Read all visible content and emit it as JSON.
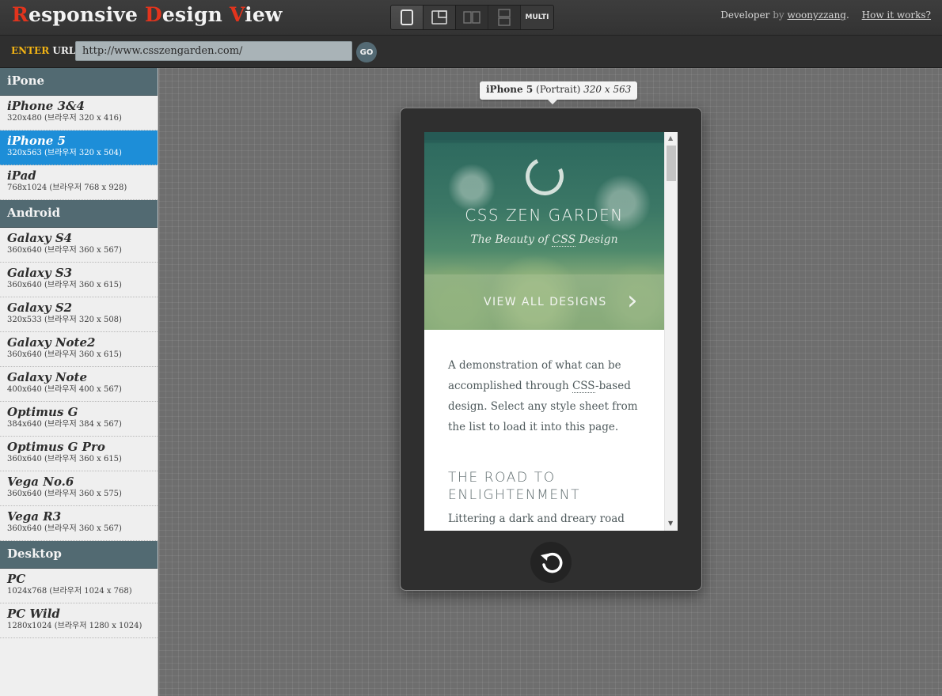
{
  "app": {
    "title_parts": [
      {
        "cap": "R",
        "rest": "esponsive "
      },
      {
        "cap": "D",
        "rest": "esign "
      },
      {
        "cap": "V",
        "rest": "iew"
      }
    ]
  },
  "toolbar": {
    "multi_label": "MULTI",
    "icons": [
      "portrait-view-icon",
      "landscape-view-icon",
      "side-by-side-view-icon",
      "stacked-view-icon"
    ]
  },
  "credit": {
    "developer_label": "Developer",
    "by_label": "by",
    "author": "woonyzzang",
    "period": ".",
    "how_link": "How it works?"
  },
  "urlbar": {
    "label_highlight": "ENTER",
    "label_rest": " URL",
    "value": "http://www.csszengarden.com/",
    "go_label": "GO"
  },
  "sidebar": {
    "groups": [
      {
        "title": "iPone",
        "devices": [
          {
            "name": "iPhone 3&4",
            "spec": "320x480 (브라우저 320 x 416)"
          },
          {
            "name": "iPhone 5",
            "spec": "320x563 (브라우저 320 x 504)"
          },
          {
            "name": "iPad",
            "spec": "768x1024 (브라우저 768 x 928)"
          }
        ]
      },
      {
        "title": "Android",
        "devices": [
          {
            "name": "Galaxy S4",
            "spec": "360x640 (브라우저 360 x 567)"
          },
          {
            "name": "Galaxy S3",
            "spec": "360x640 (브라우저 360 x 615)"
          },
          {
            "name": "Galaxy S2",
            "spec": "320x533 (브라우저 320 x 508)"
          },
          {
            "name": "Galaxy Note2",
            "spec": "360x640 (브라우저 360 x 615)"
          },
          {
            "name": "Galaxy Note",
            "spec": "400x640 (브라우저 400 x 567)"
          },
          {
            "name": "Optimus G",
            "spec": "384x640 (브라우저 384 x 567)"
          },
          {
            "name": "Optimus G Pro",
            "spec": "360x640 (브라우저 360 x 615)"
          },
          {
            "name": "Vega No.6",
            "spec": "360x640 (브라우저 360 x 575)"
          },
          {
            "name": "Vega R3",
            "spec": "360x640 (브라우저 360 x 567)"
          }
        ]
      },
      {
        "title": "Desktop",
        "devices": [
          {
            "name": "PC",
            "spec": "1024x768 (브라우저 1024 x 768)"
          },
          {
            "name": "PC Wild",
            "spec": "1280x1024 (브라우저 1280 x 1024)"
          }
        ]
      }
    ],
    "selected": "iPhone 5"
  },
  "preview": {
    "device_name": "iPhone 5",
    "orientation": "(Portrait)",
    "size": "320 x 563",
    "site": {
      "title": "CSS ZEN GARDEN",
      "subtitle_pre": "The Beauty of ",
      "subtitle_abbr": "CSS",
      "subtitle_post": " Design",
      "view_all": "VIEW ALL DESIGNS",
      "intro_pre": "A demonstration of what can be accomplished through ",
      "intro_abbr": "CSS",
      "intro_post": "-based design. Select any style sheet from the list to load it into this page.",
      "heading": "THE ROAD TO ENLIGHTENMENT",
      "para_start": "Littering a dark and dreary road"
    }
  },
  "colors": {
    "accent_red": "#e2341d",
    "enter_yellow": "#f3b414",
    "group_header": "#526a72",
    "selected_blue": "#1d8ed8"
  }
}
